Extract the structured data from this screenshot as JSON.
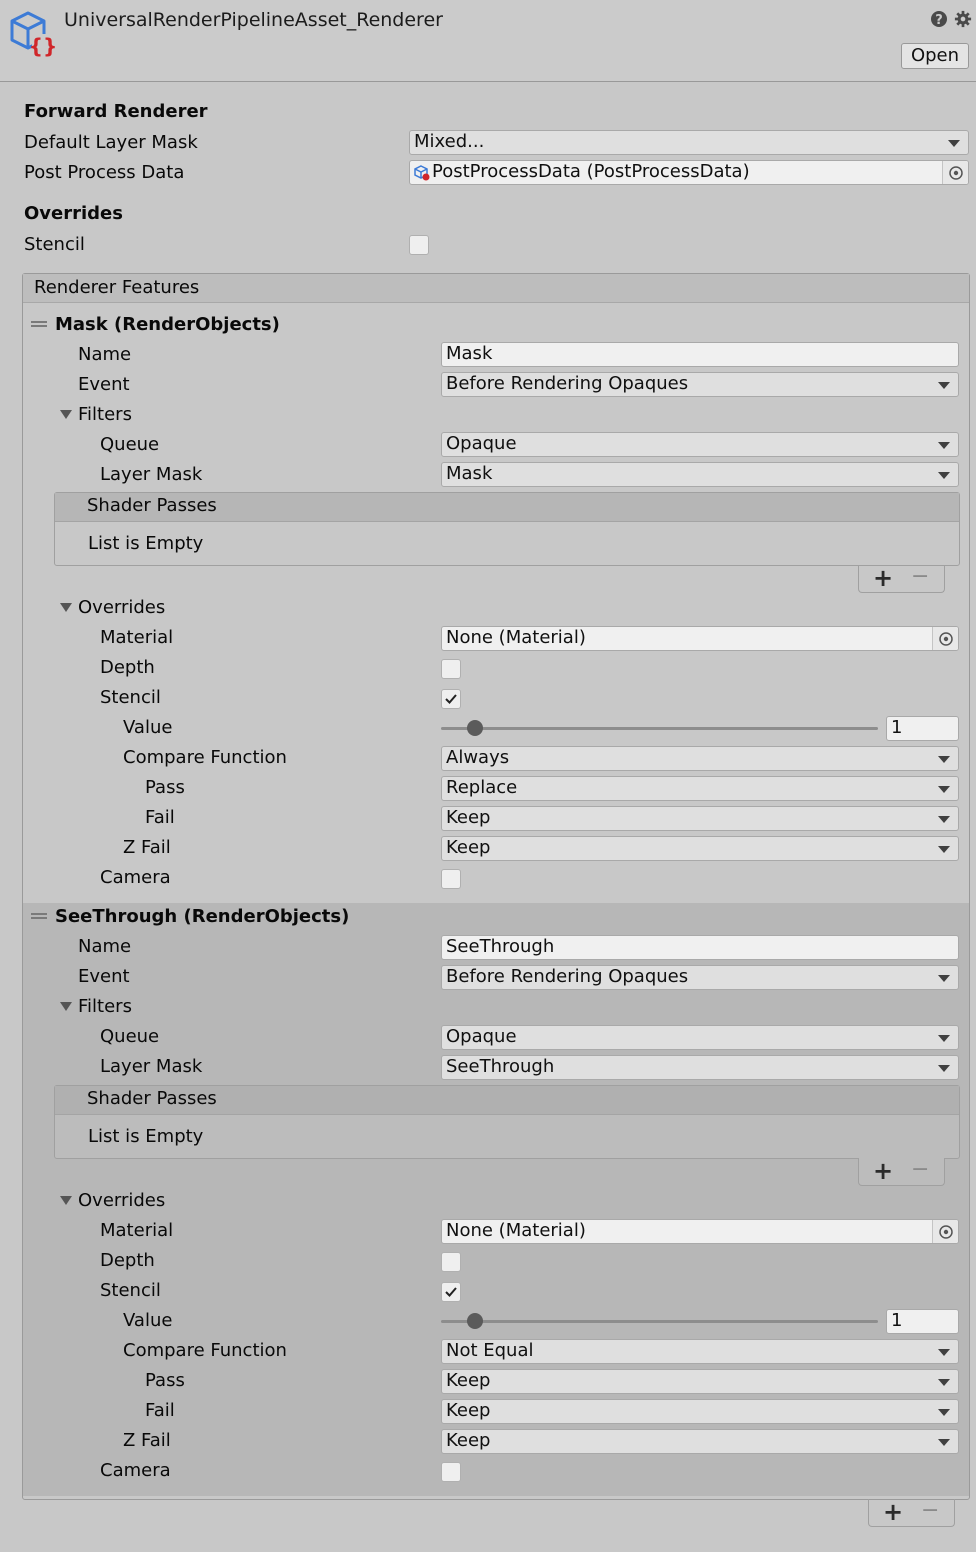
{
  "header": {
    "title": "UniversalRenderPipelineAsset_Renderer",
    "open_label": "Open",
    "icons": {
      "asset": "render-pipeline-asset-icon",
      "help": "help-icon",
      "settings": "gear-icon"
    }
  },
  "forward_renderer": {
    "section_label": "Forward Renderer",
    "default_layer_mask_label": "Default Layer Mask",
    "default_layer_mask_value": "Mixed...",
    "post_process_data_label": "Post Process Data",
    "post_process_data_value": "PostProcessData (PostProcessData)"
  },
  "overrides": {
    "section_label": "Overrides",
    "stencil_label": "Stencil",
    "stencil_checked": false
  },
  "renderer_features": {
    "header": "Renderer Features",
    "features": [
      {
        "title": "Mask (RenderObjects)",
        "name_label": "Name",
        "name_value": "Mask",
        "event_label": "Event",
        "event_value": "Before Rendering Opaques",
        "filters_label": "Filters",
        "queue_label": "Queue",
        "queue_value": "Opaque",
        "layer_mask_label": "Layer Mask",
        "layer_mask_value": "Mask",
        "shader_passes_label": "Shader Passes",
        "shader_passes_empty": "List is Empty",
        "overrides_label": "Overrides",
        "material_label": "Material",
        "material_value": "None (Material)",
        "depth_label": "Depth",
        "depth_checked": false,
        "stencil_label": "Stencil",
        "stencil_checked": true,
        "value_label": "Value",
        "value_value": "1",
        "compare_label": "Compare Function",
        "compare_value": "Always",
        "pass_label": "Pass",
        "pass_value": "Replace",
        "fail_label": "Fail",
        "fail_value": "Keep",
        "zfail_label": "Z Fail",
        "zfail_value": "Keep",
        "camera_label": "Camera",
        "camera_checked": false
      },
      {
        "title": "SeeThrough (RenderObjects)",
        "name_label": "Name",
        "name_value": "SeeThrough",
        "event_label": "Event",
        "event_value": "Before Rendering Opaques",
        "filters_label": "Filters",
        "queue_label": "Queue",
        "queue_value": "Opaque",
        "layer_mask_label": "Layer Mask",
        "layer_mask_value": "SeeThrough",
        "shader_passes_label": "Shader Passes",
        "shader_passes_empty": "List is Empty",
        "overrides_label": "Overrides",
        "material_label": "Material",
        "material_value": "None (Material)",
        "depth_label": "Depth",
        "depth_checked": false,
        "stencil_label": "Stencil",
        "stencil_checked": true,
        "value_label": "Value",
        "value_value": "1",
        "compare_label": "Compare Function",
        "compare_value": "Not Equal",
        "pass_label": "Pass",
        "pass_value": "Keep",
        "fail_label": "Fail",
        "fail_value": "Keep",
        "zfail_label": "Z Fail",
        "zfail_value": "Keep",
        "camera_label": "Camera",
        "camera_checked": false
      }
    ],
    "add_symbol": "+",
    "remove_symbol": "−"
  },
  "colors": {
    "accent_blue": "#3d7bd6",
    "accent_red": "#d0262a",
    "background": "#c8c8c8"
  }
}
